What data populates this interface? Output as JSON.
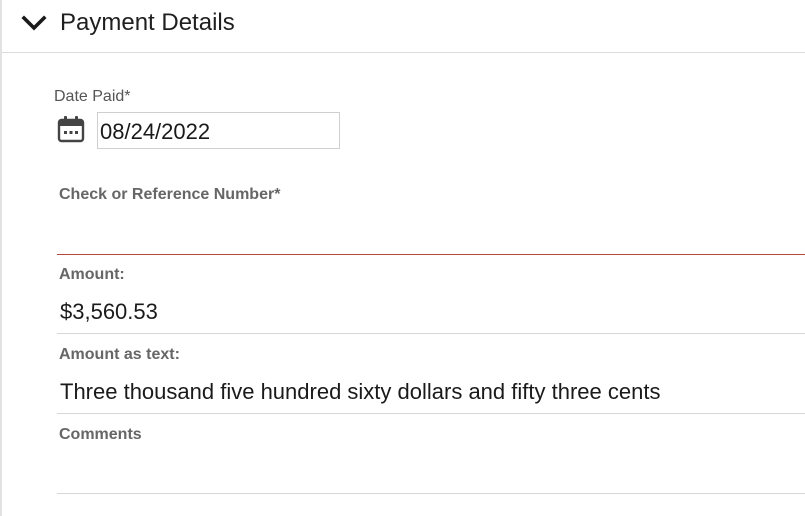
{
  "section": {
    "title": "Payment Details"
  },
  "date_paid": {
    "label": "Date Paid*",
    "value": "08/24/2022"
  },
  "reference": {
    "label": "Check or Reference Number*",
    "value": ""
  },
  "amount": {
    "label": "Amount:",
    "value": "$3,560.53"
  },
  "amount_text": {
    "label": "Amount as text:",
    "value": "Three thousand five hundred sixty dollars and fifty three cents"
  },
  "comments": {
    "label": "Comments",
    "value": ""
  },
  "colors": {
    "error_underline": "#b5483e",
    "divider": "#d8d8d8"
  },
  "icons": {
    "collapse": "chevron-down-icon",
    "date_picker": "calendar-icon"
  }
}
